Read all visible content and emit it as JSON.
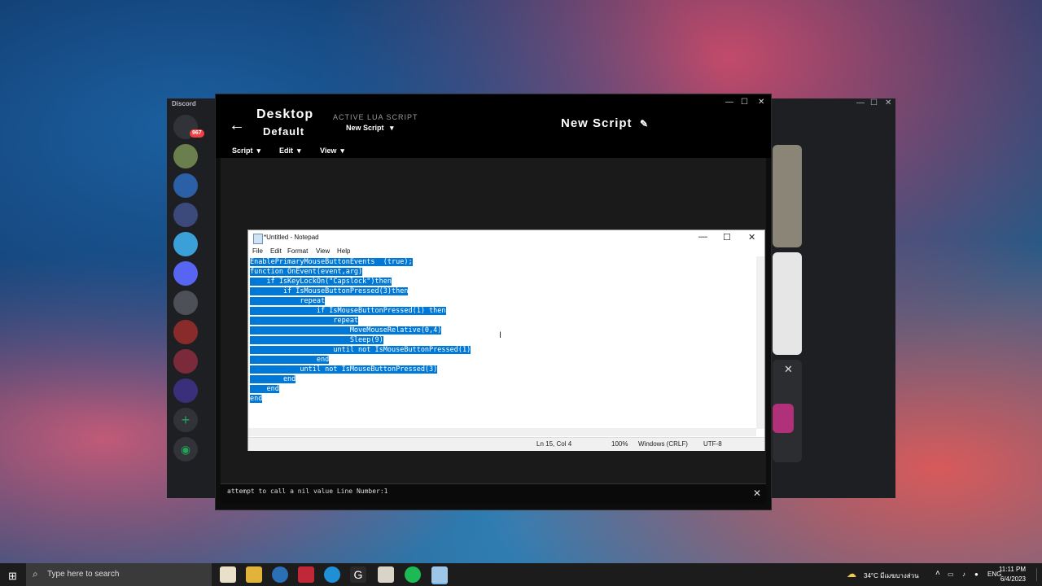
{
  "discord": {
    "title": "Discord",
    "badge": "967",
    "controls": {
      "minimize": "—",
      "maximize": "☐",
      "close": "✕"
    }
  },
  "ghub": {
    "desktop": "Desktop",
    "profile": "Default",
    "active_label": "ACTIVE LUA SCRIPT",
    "active_script": "New Script",
    "script_name": "New Script",
    "menus": [
      "Script",
      "Edit",
      "View"
    ],
    "console_message": "attempt to call a nil value Line Number:1",
    "controls": {
      "minimize": "—",
      "maximize": "☐",
      "close": "✕"
    }
  },
  "notepad": {
    "title": "*Untitled - Notepad",
    "menus": [
      "File",
      "Edit",
      "Format",
      "View",
      "Help"
    ],
    "code_lines": [
      "EnablePrimaryMouseButtonEvents  (true);",
      "function OnEvent(event,arg)",
      "    if IsKeyLockOn(\"Capslock\")then",
      "        if IsMouseButtonPressed(3)then",
      "            repeat",
      "                if IsMouseButtonPressed(1) then",
      "                    repeat",
      "                        MoveMouseRelative(0,4)",
      "                        Sleep(9)",
      "                    until not IsMouseButtonPressed(1)",
      "                end",
      "            until not IsMouseButtonPressed(3)",
      "        end",
      "    end",
      "end"
    ],
    "status": {
      "position": "Ln 15, Col 4",
      "zoom": "100%",
      "line_ending": "Windows (CRLF)",
      "encoding": "UTF-8"
    }
  },
  "taskbar": {
    "search_placeholder": "Type here to search",
    "weather": "34°C  มีเมฆบางส่วน",
    "language": "ENG",
    "time": "11:11 PM",
    "date": "6/4/2023"
  },
  "colors": {
    "selection": "#0078d7",
    "ghub_bg": "#0d0d0d",
    "discord_bg": "#1e1f22",
    "taskbar_bg": "#1c1c1c"
  }
}
